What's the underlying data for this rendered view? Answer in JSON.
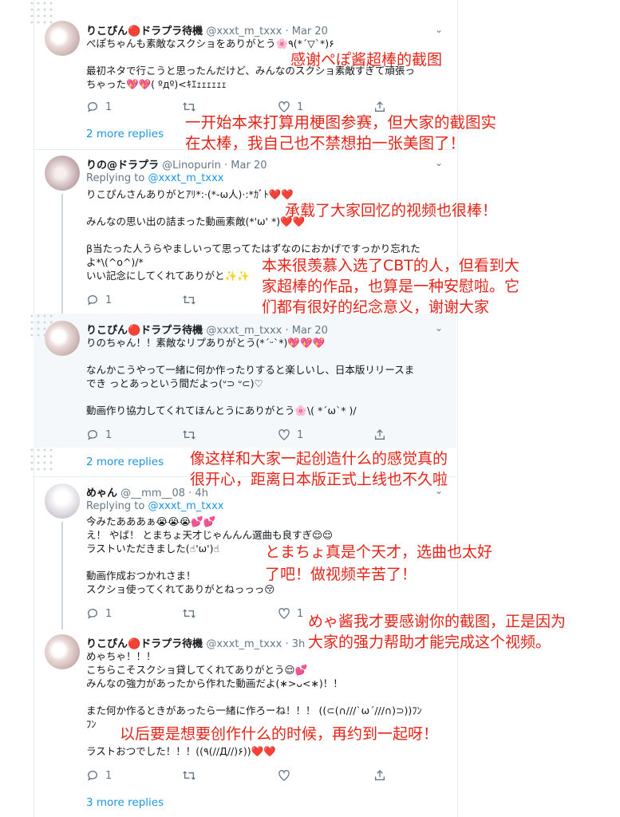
{
  "tweets": [
    {
      "name": "りこぴん🔴ドラプラ待機",
      "handle": "@xxxt_m_txxx · Mar 20",
      "text": "ぺぽちゃんも素敵なスクショをありがとう🌸٩(*´▽`*)۶\n\n最初ネタで行こうと思ったんだけど、みんなのスクショ素敵すぎて頑張っ\nちゃった💖💖( ºдº)<ｷｴｪｪｪｪｪｪ",
      "replies": "1",
      "retweets": "",
      "likes": "1",
      "more_replies": "2 more replies"
    },
    {
      "name": "りの@ドラプラ",
      "handle": "@Linopurin · Mar 20",
      "replying_prefix": "Replying to ",
      "replying_to": "@xxxt_m_txxx",
      "text": "りこぴんさんありがとｱﾘ*:·(*-ω人)·:*ｶﾞﾄ❤️❤️\n\nみんなの思い出の詰まった動画素敵(*'ω' *)❤️❤️\n\nβ当たった人うらやましいって思ってたはずなのにおかげですっかり忘れた\nよ*\\(^o^)/*\nいい記念にしてくれてありがと✨✨",
      "replies": "1",
      "retweets": "",
      "likes": ""
    },
    {
      "name": "りこぴん🔴ドラプラ待機",
      "handle": "@xxxt_m_txxx · Mar 20",
      "text": "りのちゃん！！素敵なリプありがとう(*´ᵕ`*)💖💖💖\n\nなんかこうやって一緒に何か作ったりすると楽しいし、日本版リリースま\nでき っとあっという間だよっ(ᐡ⊃ ᐡ⊂)♡\n\n動画作り協力してくれてほんとうにありがとう🌸\\( *´ω`* )/",
      "replies": "1",
      "retweets": "",
      "likes": "1",
      "more_replies": "2 more replies"
    },
    {
      "name": "めゃん",
      "handle": "@__mm__08 · 4h",
      "replying_prefix": "Replying to ",
      "replying_to": "@xxxt_m_txxx",
      "text": "今みたあああぁ😭😭😭💕💕\nえ！ やば！ とまちょ天才じゃんんん選曲も良すぎ😌😌\nラストいただきました(☝︎'ω')☝︎\n\n動画作成おつかれさま！\nスクショ使ってくれてありがとねっっっ😚",
      "replies": "1",
      "retweets": "",
      "likes": "1"
    },
    {
      "name": "りこぴん🔴ドラプラ待機",
      "handle": "@xxxt_m_txxx · 3h",
      "text": "めゃちゃ！！！\nこちらこそスクショ貸してくれてありがとう😌💕\nみんなの強力があったから作れた動画だよ(∗>ᴗ<∗)！！\n\nまた何か作るときがあったら一緒に作ろーね！！！ ((⊂(∩///`ω´///∩)⊃))ﾌﾝ\nﾌﾝ\n\nラストおつでした！！！((٩(//Д//)۶))❤️❤️",
      "replies": "1",
      "retweets": "",
      "likes": "",
      "more_replies": "3 more replies"
    }
  ],
  "annotations": [
    "感谢ぺぽ酱超棒的截图",
    "一开始本来打算用梗图参赛，但大家的截图实\n在太棒，我自己也不禁想拍一张美图了！",
    "承载了大家回忆的视频也很棒！",
    "本来很羡慕入选了CBT的人，但看到大\n家超棒的作品，也算是一种安慰啦。它\n们都有很好的纪念意义，谢谢大家",
    "像这样和大家一起创造什么的感觉真的\n很开心，距离日本版正式上线也不久啦",
    "とまちょ真是个天才，选曲也太好\n了吧！做视频辛苦了！",
    "めゃ酱我才要感谢你的截图，正是因为\n大家的强力帮助才能完成这个视频。",
    "以后要是想要创作什么的时候，再约到一起呀！"
  ],
  "colors": {
    "accent": "#1b95e0",
    "annotation": "#e52418",
    "muted": "#657786"
  },
  "icons": [
    "reply-icon",
    "retweet-icon",
    "like-icon",
    "share-icon",
    "chevron-down-icon"
  ]
}
